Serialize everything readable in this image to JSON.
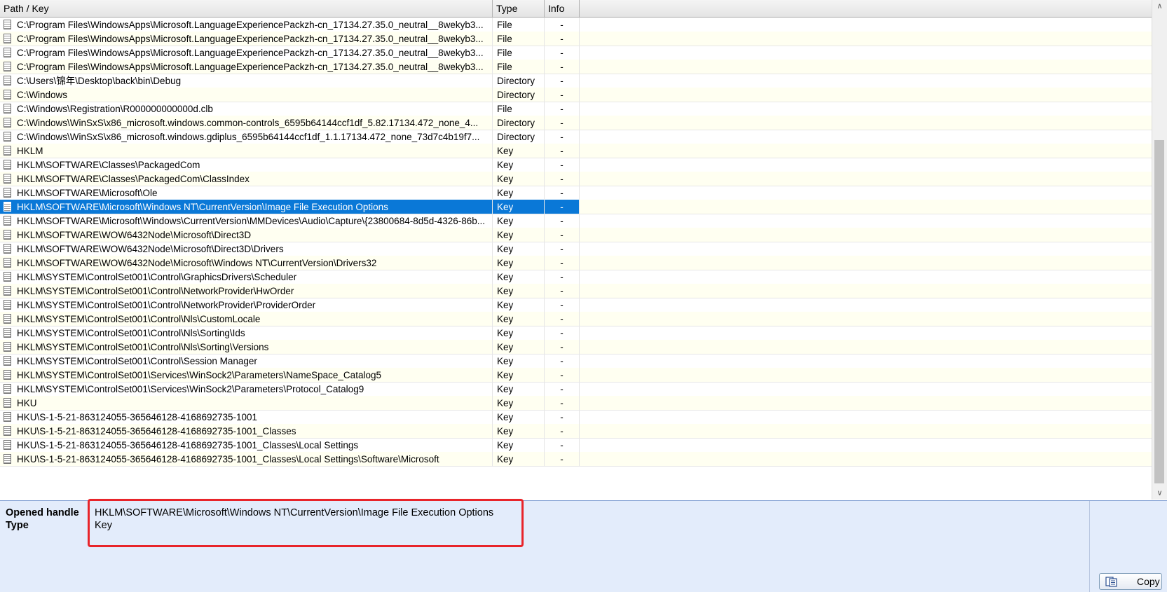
{
  "columns": {
    "path": "Path / Key",
    "type": "Type",
    "info": "Info"
  },
  "rows": [
    {
      "path": "C:\\Program Files\\WindowsApps\\Microsoft.LanguageExperiencePackzh-cn_17134.27.35.0_neutral__8wekyb3...",
      "type": "File",
      "info": "-"
    },
    {
      "path": "C:\\Program Files\\WindowsApps\\Microsoft.LanguageExperiencePackzh-cn_17134.27.35.0_neutral__8wekyb3...",
      "type": "File",
      "info": "-"
    },
    {
      "path": "C:\\Program Files\\WindowsApps\\Microsoft.LanguageExperiencePackzh-cn_17134.27.35.0_neutral__8wekyb3...",
      "type": "File",
      "info": "-"
    },
    {
      "path": "C:\\Program Files\\WindowsApps\\Microsoft.LanguageExperiencePackzh-cn_17134.27.35.0_neutral__8wekyb3...",
      "type": "File",
      "info": "-"
    },
    {
      "path": "C:\\Users\\锦年\\Desktop\\back\\bin\\Debug",
      "type": "Directory",
      "info": "-"
    },
    {
      "path": "C:\\Windows",
      "type": "Directory",
      "info": "-"
    },
    {
      "path": "C:\\Windows\\Registration\\R000000000000d.clb",
      "type": "File",
      "info": "-"
    },
    {
      "path": "C:\\Windows\\WinSxS\\x86_microsoft.windows.common-controls_6595b64144ccf1df_5.82.17134.472_none_4...",
      "type": "Directory",
      "info": "-"
    },
    {
      "path": "C:\\Windows\\WinSxS\\x86_microsoft.windows.gdiplus_6595b64144ccf1df_1.1.17134.472_none_73d7c4b19f7...",
      "type": "Directory",
      "info": "-"
    },
    {
      "path": "HKLM",
      "type": "Key",
      "info": "-"
    },
    {
      "path": "HKLM\\SOFTWARE\\Classes\\PackagedCom",
      "type": "Key",
      "info": "-"
    },
    {
      "path": "HKLM\\SOFTWARE\\Classes\\PackagedCom\\ClassIndex",
      "type": "Key",
      "info": "-"
    },
    {
      "path": "HKLM\\SOFTWARE\\Microsoft\\Ole",
      "type": "Key",
      "info": "-"
    },
    {
      "path": "HKLM\\SOFTWARE\\Microsoft\\Windows NT\\CurrentVersion\\Image File Execution Options",
      "type": "Key",
      "info": "-"
    },
    {
      "path": "HKLM\\SOFTWARE\\Microsoft\\Windows\\CurrentVersion\\MMDevices\\Audio\\Capture\\{23800684-8d5d-4326-86b...",
      "type": "Key",
      "info": "-"
    },
    {
      "path": "HKLM\\SOFTWARE\\WOW6432Node\\Microsoft\\Direct3D",
      "type": "Key",
      "info": "-"
    },
    {
      "path": "HKLM\\SOFTWARE\\WOW6432Node\\Microsoft\\Direct3D\\Drivers",
      "type": "Key",
      "info": "-"
    },
    {
      "path": "HKLM\\SOFTWARE\\WOW6432Node\\Microsoft\\Windows NT\\CurrentVersion\\Drivers32",
      "type": "Key",
      "info": "-"
    },
    {
      "path": "HKLM\\SYSTEM\\ControlSet001\\Control\\GraphicsDrivers\\Scheduler",
      "type": "Key",
      "info": "-"
    },
    {
      "path": "HKLM\\SYSTEM\\ControlSet001\\Control\\NetworkProvider\\HwOrder",
      "type": "Key",
      "info": "-"
    },
    {
      "path": "HKLM\\SYSTEM\\ControlSet001\\Control\\NetworkProvider\\ProviderOrder",
      "type": "Key",
      "info": "-"
    },
    {
      "path": "HKLM\\SYSTEM\\ControlSet001\\Control\\Nls\\CustomLocale",
      "type": "Key",
      "info": "-"
    },
    {
      "path": "HKLM\\SYSTEM\\ControlSet001\\Control\\Nls\\Sorting\\Ids",
      "type": "Key",
      "info": "-"
    },
    {
      "path": "HKLM\\SYSTEM\\ControlSet001\\Control\\Nls\\Sorting\\Versions",
      "type": "Key",
      "info": "-"
    },
    {
      "path": "HKLM\\SYSTEM\\ControlSet001\\Control\\Session Manager",
      "type": "Key",
      "info": "-"
    },
    {
      "path": "HKLM\\SYSTEM\\ControlSet001\\Services\\WinSock2\\Parameters\\NameSpace_Catalog5",
      "type": "Key",
      "info": "-"
    },
    {
      "path": "HKLM\\SYSTEM\\ControlSet001\\Services\\WinSock2\\Parameters\\Protocol_Catalog9",
      "type": "Key",
      "info": "-"
    },
    {
      "path": "HKU",
      "type": "Key",
      "info": "-"
    },
    {
      "path": "HKU\\S-1-5-21-863124055-365646128-4168692735-1001",
      "type": "Key",
      "info": "-"
    },
    {
      "path": "HKU\\S-1-5-21-863124055-365646128-4168692735-1001_Classes",
      "type": "Key",
      "info": "-"
    },
    {
      "path": "HKU\\S-1-5-21-863124055-365646128-4168692735-1001_Classes\\Local Settings",
      "type": "Key",
      "info": "-"
    },
    {
      "path": "HKU\\S-1-5-21-863124055-365646128-4168692735-1001_Classes\\Local Settings\\Software\\Microsoft",
      "type": "Key",
      "info": "-"
    }
  ],
  "selected_row": 13,
  "details": {
    "labels": {
      "opened_handle": "Opened handle",
      "type": "Type"
    },
    "opened_handle": "HKLM\\SOFTWARE\\Microsoft\\Windows NT\\CurrentVersion\\Image File Execution Options",
    "type": "Key"
  },
  "copy_button": {
    "label": "Copy",
    "icon": "copy-icon"
  },
  "scrollbar": {
    "up_icon": "chevron-up-icon",
    "down_icon": "chevron-down-icon"
  },
  "colors": {
    "selection": "#0a78d7",
    "details_background": "#e3ecfb",
    "highlight_border": "#e8242a",
    "row_tint": "#fffff1"
  }
}
